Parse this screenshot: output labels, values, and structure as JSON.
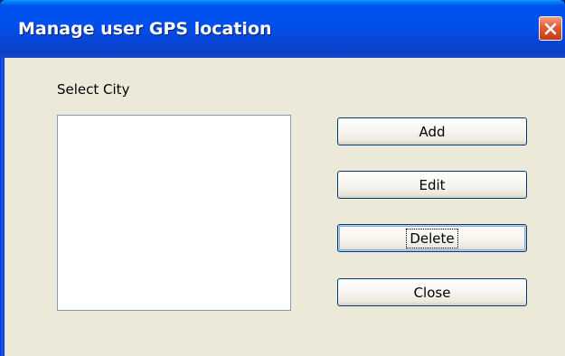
{
  "window": {
    "title": "Manage user GPS location",
    "close_icon": "close-icon"
  },
  "form": {
    "select_city_label": "Select City",
    "city_list": []
  },
  "buttons": {
    "add": "Add",
    "edit": "Edit",
    "delete": "Delete",
    "close": "Close"
  },
  "colors": {
    "titlebar": "#0053ee",
    "dialog_bg": "#ece9d8",
    "close_button": "#e0603a",
    "button_border": "#003c74"
  }
}
